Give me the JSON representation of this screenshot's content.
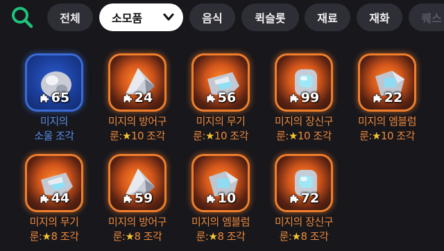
{
  "header": {
    "search_icon": "search-icon",
    "accent_color": "#1fc27a",
    "tabs": [
      {
        "label": "전체",
        "selected": false
      },
      {
        "label": "소모품",
        "selected": true,
        "icon": "chevron-down-icon"
      },
      {
        "label": "음식",
        "selected": false
      },
      {
        "label": "퀵슬롯",
        "selected": false
      },
      {
        "label": "재료",
        "selected": false
      },
      {
        "label": "재화",
        "selected": false
      },
      {
        "label": "퀘스",
        "selected": false
      }
    ]
  },
  "items": [
    {
      "count": "65",
      "line1": "미지의",
      "star": "",
      "line2": "소울 조각",
      "rarity": "blue",
      "icon": "soul-fragment-icon"
    },
    {
      "count": "24",
      "line1": "미지의 방어구",
      "star": "★",
      "line2": "10 조각",
      "line2_prefix": "룬:",
      "rarity": "orange",
      "icon": "armor-rune-fragment-icon"
    },
    {
      "count": "56",
      "line1": "미지의 무기",
      "star": "★",
      "line2": "10 조각",
      "line2_prefix": "룬:",
      "rarity": "orange",
      "icon": "weapon-rune-fragment-icon"
    },
    {
      "count": "99",
      "line1": "미지의 장신구",
      "star": "★",
      "line2": "10 조각",
      "line2_prefix": "룬:",
      "rarity": "orange",
      "icon": "accessory-rune-fragment-icon"
    },
    {
      "count": "22",
      "line1": "미지의 엠블럼",
      "star": "★",
      "line2": "10 조각",
      "line2_prefix": "룬:",
      "rarity": "orange",
      "icon": "emblem-rune-fragment-icon"
    },
    {
      "count": "44",
      "line1": "미지의 무기",
      "star": "★",
      "line2": "8 조각",
      "line2_prefix": "룬:",
      "rarity": "orange",
      "icon": "weapon-rune-fragment-icon"
    },
    {
      "count": "59",
      "line1": "미지의 방어구",
      "star": "★",
      "line2": "8 조각",
      "line2_prefix": "룬:",
      "rarity": "orange",
      "icon": "armor-rune-fragment-icon"
    },
    {
      "count": "10",
      "line1": "미지의 엠블럼",
      "star": "★",
      "line2": "8 조각",
      "line2_prefix": "룬:",
      "rarity": "orange",
      "icon": "emblem-rune-fragment-icon"
    },
    {
      "count": "72",
      "line1": "미지의 장신구",
      "star": "★",
      "line2": "8 조각",
      "line2_prefix": "룬:",
      "rarity": "orange",
      "icon": "accessory-rune-fragment-icon"
    }
  ]
}
